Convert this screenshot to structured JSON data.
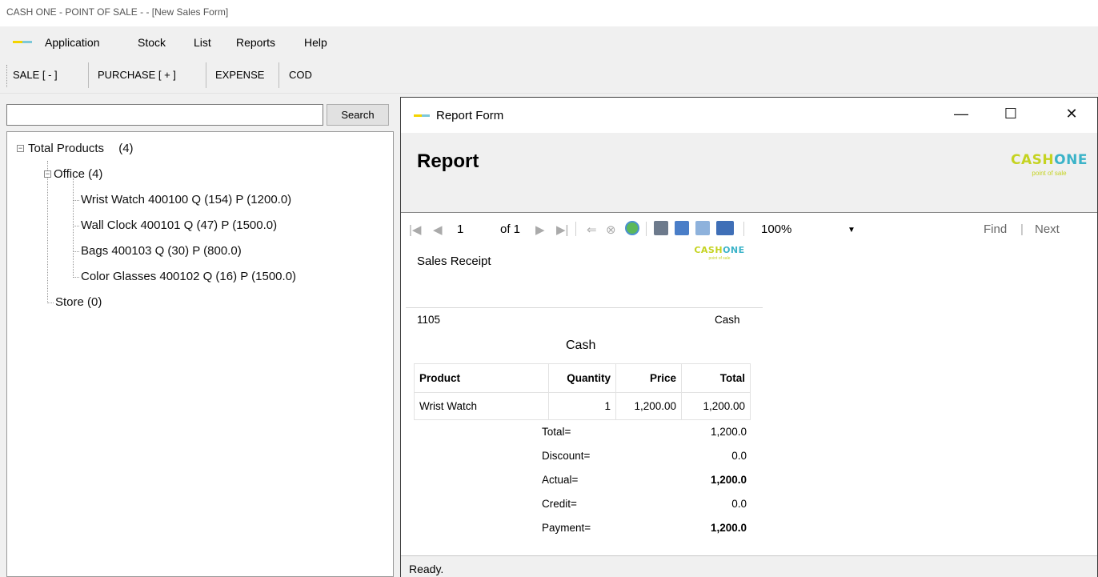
{
  "window": {
    "title": "CASH ONE - POINT OF SALE -  - [New Sales Form]"
  },
  "menu": {
    "items": [
      "Application",
      "Stock",
      "List",
      "Reports",
      "Help"
    ]
  },
  "toolbar": {
    "buttons": [
      "SALE [ - ]",
      "PURCHASE [ + ]",
      "EXPENSE",
      "COD"
    ]
  },
  "search": {
    "value": "",
    "button_label": "Search"
  },
  "tree": {
    "root": {
      "label": "Total Products",
      "count": "(4)"
    },
    "office": {
      "label": "Office (4)"
    },
    "items": [
      "Wrist Watch  400100   Q (154)   P (1200.0)",
      "Wall Clock  400101   Q (47)   P (1500.0)",
      "Bags  400103   Q (30)   P (800.0)",
      "Color Glasses  400102   Q (16)   P (1500.0)"
    ],
    "store": {
      "label": "Store (0)"
    }
  },
  "report_window": {
    "title": "Report Form",
    "heading": "Report",
    "brand": {
      "part1": "CASH",
      "part2": "ONE",
      "tagline": "point of sale"
    },
    "controls": {
      "minimize": "—",
      "maximize": "☐",
      "close": "✕"
    }
  },
  "viewer": {
    "page": "1",
    "of": "of 1",
    "zoom": "100%",
    "find_label": "Find",
    "next_label": "Next"
  },
  "receipt": {
    "title": "Sales Receipt",
    "number": "1105",
    "payment_type_right": "Cash",
    "payment_type_center": "Cash",
    "columns": [
      "Product",
      "Quantity",
      "Price",
      "Total"
    ],
    "rows": [
      {
        "product": "Wrist Watch",
        "quantity": "1",
        "price": "1,200.00",
        "total": "1,200.00"
      }
    ],
    "summary": [
      {
        "label": "Total=",
        "value": "1,200.0",
        "bold": false
      },
      {
        "label": "Discount=",
        "value": "0.0",
        "bold": false
      },
      {
        "label": "Actual=",
        "value": "1,200.0",
        "bold": true
      },
      {
        "label": "Credit=",
        "value": "0.0",
        "bold": false
      },
      {
        "label": "Payment=",
        "value": "1,200.0",
        "bold": true
      }
    ]
  },
  "status": {
    "text": "Ready."
  }
}
